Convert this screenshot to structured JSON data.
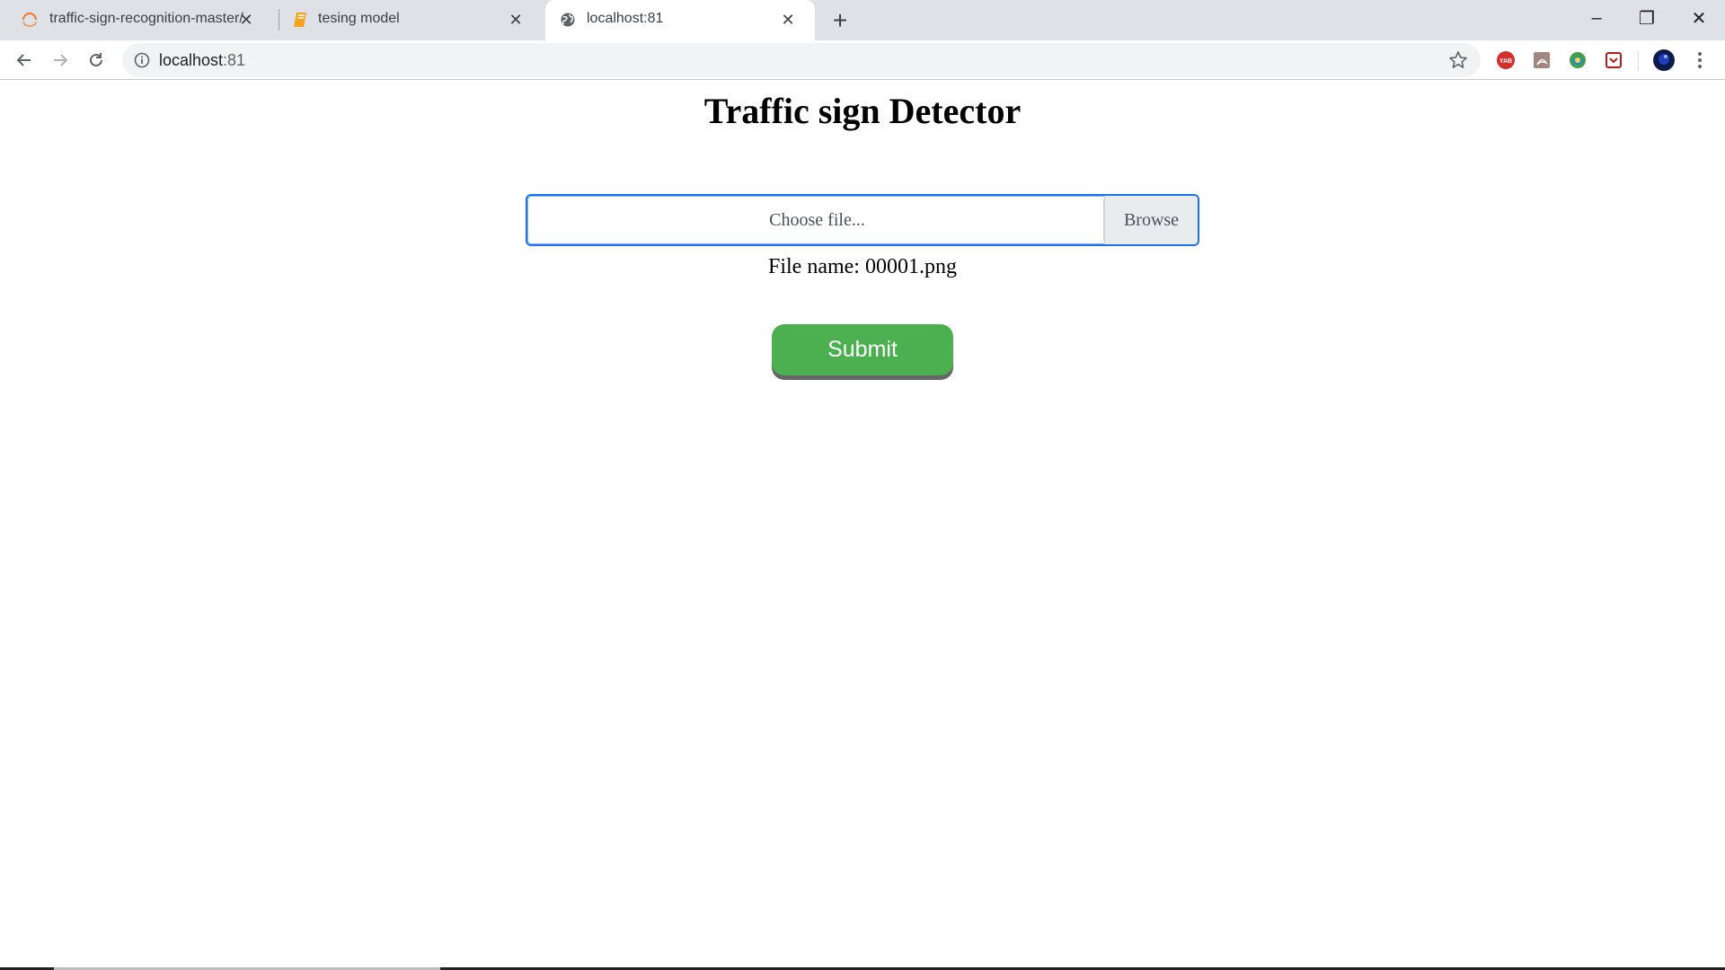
{
  "browser": {
    "tabs": [
      {
        "title": "traffic-sign-recognition-master/",
        "favicon": "loading-spinner-icon",
        "active": false
      },
      {
        "title": "tesing model",
        "favicon": "notebook-icon",
        "active": false
      },
      {
        "title": "localhost:81",
        "favicon": "globe-icon",
        "active": true
      }
    ],
    "new_tab_label": "+",
    "window_controls": {
      "minimize": "–",
      "restore": "❐",
      "close": "✕"
    },
    "address": {
      "host": "localhost",
      "port": ":81"
    },
    "extensions": [
      "yab-extension-icon",
      "pdf-extension-icon",
      "idm-extension-icon",
      "pocket-extension-icon",
      "profile-avatar-icon",
      "menu-dots-icon"
    ]
  },
  "page": {
    "title": "Traffic sign Detector",
    "file_input": {
      "placeholder": "Choose file...",
      "browse_label": "Browse"
    },
    "file_name_text": "File name: 00001.png",
    "submit_label": "Submit"
  },
  "colors": {
    "accent_focus": "#1a73e8",
    "submit_bg": "#4caf50",
    "tabstrip_bg": "#dee1e6"
  }
}
